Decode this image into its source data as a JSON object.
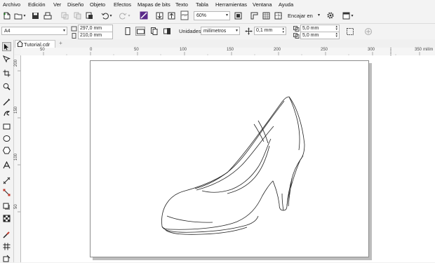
{
  "menubar": {
    "items": [
      "Archivo",
      "Edición",
      "Ver",
      "Diseño",
      "Objeto",
      "Efectos",
      "Mapas de bits",
      "Texto",
      "Tabla",
      "Herramientas",
      "Ventana",
      "Ayuda"
    ]
  },
  "toolbar": {
    "zoom_value": "60%",
    "snap_label": "Encajar en"
  },
  "property_bar": {
    "page_size": "A4",
    "width_value": "297,0 mm",
    "height_value": "210,0 mm",
    "units_label": "Unidades:",
    "units_value": "milímetros",
    "nudge_value": "0,1 mm",
    "dup_x_value": "5,0 mm",
    "dup_y_value": "5,0 mm"
  },
  "tabs": {
    "active_tab": "Tutorial.cdr",
    "add_tab": "+"
  },
  "h_ruler": {
    "labels": [
      "50",
      "0",
      "50",
      "100",
      "150",
      "200",
      "250",
      "300",
      "350"
    ],
    "units": "milím"
  },
  "v_ruler": {
    "labels": [
      "200",
      "150",
      "100",
      "50"
    ]
  },
  "icons": {
    "new": "new-document-icon",
    "open": "open-folder-icon",
    "save": "save-icon",
    "print": "print-icon"
  }
}
